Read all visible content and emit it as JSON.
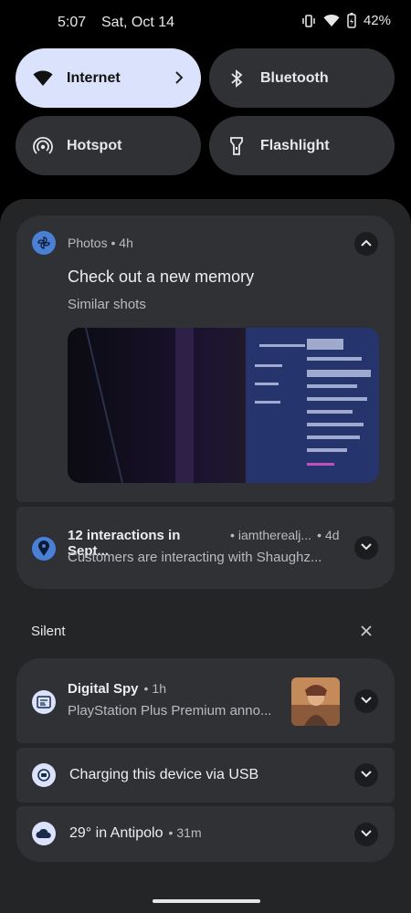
{
  "status_bar": {
    "time": "5:07",
    "date": "Sat, Oct 14",
    "battery": "42%",
    "icons": [
      "vibrate-icon",
      "wifi-icon",
      "battery-charging-icon"
    ]
  },
  "quick_tiles": [
    {
      "label": "Internet",
      "icon": "wifi-icon",
      "active": true
    },
    {
      "label": "Bluetooth",
      "icon": "bluetooth-icon",
      "active": false
    },
    {
      "label": "Hotspot",
      "icon": "hotspot-icon",
      "active": false
    },
    {
      "label": "Flashlight",
      "icon": "flashlight-icon",
      "active": false
    }
  ],
  "notifications": {
    "photos": {
      "app": "Photos",
      "time": "4h",
      "title": "Check out a new memory",
      "text": "Similar shots",
      "icon": "photos-pinwheel-icon"
    },
    "maps": {
      "title": "12 interactions in Sept...",
      "account": "iamtherealj...",
      "time": "4d",
      "text": "Customers are interacting with Shaughz...",
      "icon": "location-pin-icon"
    }
  },
  "silent_section": {
    "label": "Silent",
    "items": [
      {
        "app": "Digital Spy",
        "time": "1h",
        "text": "PlayStation Plus Premium anno...",
        "icon": "news-icon"
      },
      {
        "title": "Charging this device via USB",
        "icon": "usb-charging-icon"
      },
      {
        "title": "29° in Antipolo",
        "time": "31m",
        "icon": "cloud-icon"
      }
    ]
  },
  "colors": {
    "background": "#000000",
    "shade": "#242527",
    "card": "#2f3134",
    "tile_active": "#dbe2fb",
    "accent_blue": "#4a7fd6"
  }
}
